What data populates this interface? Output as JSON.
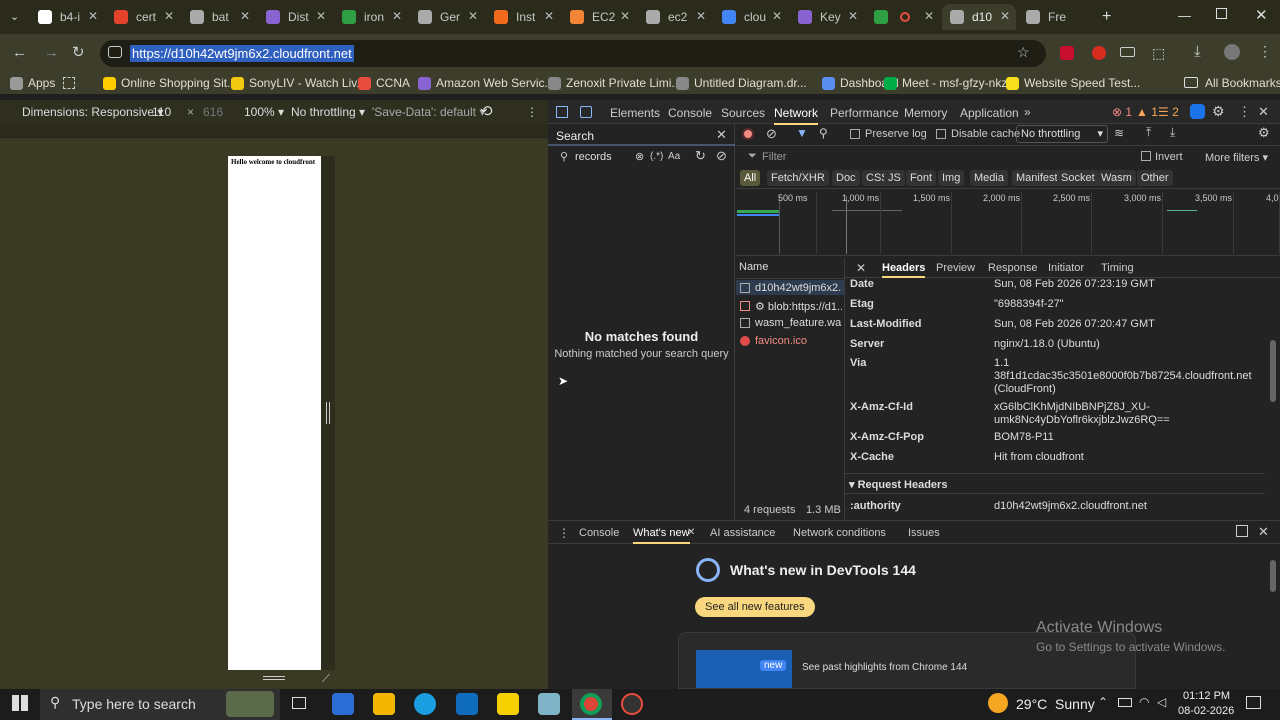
{
  "browser": {
    "tabs": [
      {
        "label": "b4-i",
        "color": "#ffffff"
      },
      {
        "label": "cert",
        "color": "#e24329"
      },
      {
        "label": "bat",
        "color": "#aaaaaa"
      },
      {
        "label": "Dist",
        "color": "#8a63d2"
      },
      {
        "label": "iron",
        "color": "#2ea043"
      },
      {
        "label": "Ger",
        "color": "#aaaaaa"
      },
      {
        "label": "Inst",
        "color": "#f26b1d"
      },
      {
        "label": "EC2",
        "color": "#f58536"
      },
      {
        "label": "ec2",
        "color": "#aaaaaa"
      },
      {
        "label": "clou",
        "color": "#4285f4"
      },
      {
        "label": "Key",
        "color": "#8a63d2"
      },
      {
        "label": "",
        "color": "#2ea043"
      },
      {
        "label": "d10",
        "color": "#aaaaaa"
      },
      {
        "label": "Fre",
        "color": "#aaaaaa"
      }
    ],
    "url": "https://d10h42wt9jm6x2.cloudfront.net",
    "bookmarks": [
      {
        "label": "Apps",
        "color": "#9a9a9a"
      },
      {
        "label": "Online Shopping Sit...",
        "color": "#ffcc00"
      },
      {
        "label": "SonyLIV - Watch Liv...",
        "color": "#f2c811"
      },
      {
        "label": "CCNA",
        "color": "#e84c3d"
      },
      {
        "label": "Amazon Web Servic...",
        "color": "#8a63d2"
      },
      {
        "label": "Zenoxit Private Limi...",
        "color": "#888888"
      },
      {
        "label": "Untitled Diagram.dr...",
        "color": "#888888"
      },
      {
        "label": "Dashboard",
        "color": "#5b8def"
      },
      {
        "label": "Meet - msf-gfzy-nkz",
        "color": "#00ac47"
      },
      {
        "label": "Website Speed Test...",
        "color": "#f7df1e"
      }
    ],
    "all_bookmarks": "All Bookmarks"
  },
  "device_toolbar": {
    "dimensions": "Dimensions: Responsive",
    "width": "110",
    "height": "616",
    "zoom": "100%",
    "throttling": "No throttling",
    "save_data": "'Save-Data': default"
  },
  "page": {
    "text": "Hello welcome to cloudfront"
  },
  "devtools": {
    "tabs": [
      "Elements",
      "Console",
      "Sources",
      "Network",
      "Performance",
      "Memory",
      "Application"
    ],
    "active_tab": "Network",
    "errors": "1",
    "warnings": "1",
    "info": "2",
    "search": {
      "title": "Search",
      "query": "records",
      "regex": "(.*)",
      "case": "Aa",
      "no_matches": "No matches found",
      "no_matches_sub": "Nothing matched your search query"
    },
    "network": {
      "preserve_log": "Preserve log",
      "disable_cache": "Disable cache",
      "throttling": "No throttling",
      "filter_placeholder": "Filter",
      "invert": "Invert",
      "more_filters": "More filters",
      "types": [
        "All",
        "Fetch/XHR",
        "Doc",
        "CSS",
        "JS",
        "Font",
        "Img",
        "Media",
        "Manifest",
        "Socket",
        "Wasm",
        "Other"
      ],
      "timeline_ticks": [
        "500 ms",
        "1,000 ms",
        "1,500 ms",
        "2,000 ms",
        "2,500 ms",
        "3,000 ms",
        "3,500 ms",
        "4,0"
      ],
      "name_header": "Name",
      "requests": [
        {
          "name": "d10h42wt9jm6x2....",
          "error": false
        },
        {
          "name": "⚙ blob:https://d1...",
          "error": false
        },
        {
          "name": "wasm_feature.wa...",
          "error": false
        },
        {
          "name": "favicon.ico",
          "error": true
        }
      ],
      "summary": "4 requests",
      "transferred": "1.3 MB tr",
      "detail_tabs": [
        "Headers",
        "Preview",
        "Response",
        "Initiator",
        "Timing"
      ],
      "headers": [
        {
          "k": "Date",
          "v": "Sun, 08 Feb 2026 07:23:19 GMT"
        },
        {
          "k": "Etag",
          "v": "\"6988394f-27\""
        },
        {
          "k": "Last-Modified",
          "v": "Sun, 08 Feb 2026 07:20:47 GMT"
        },
        {
          "k": "Server",
          "v": "nginx/1.18.0 (Ubuntu)"
        },
        {
          "k": "Via",
          "v": "1.1 38f1d1cdac35c3501e8000f0b7b87254.cloudfront.net (CloudFront)"
        },
        {
          "k": "X-Amz-Cf-Id",
          "v": "xG6lbClKhMjdNIbBNPjZ8J_XU-umk8Nc4yDbYoflr6kxjblzJwz6RQ=="
        },
        {
          "k": "X-Amz-Cf-Pop",
          "v": "BOM78-P11"
        },
        {
          "k": "X-Cache",
          "v": "Hit from cloudfront"
        }
      ],
      "request_headers_title": "▾ Request Headers",
      "authority_key": ":authority",
      "authority_val": "d10h42wt9jm6x2.cloudfront.net"
    },
    "drawer": {
      "tabs": [
        "Console",
        "What's new",
        "AI assistance",
        "Network conditions",
        "Issues"
      ],
      "active": "What's new",
      "title": "What's new in DevTools 144",
      "see_all": "See all new features",
      "badge": "new",
      "highlights": "See past highlights from Chrome 144",
      "activate_title": "Activate Windows",
      "activate_sub": "Go to Settings to activate Windows."
    }
  },
  "taskbar": {
    "search_placeholder": "Type here to search",
    "weather": "29°C  Sunny",
    "time": "01:12 PM",
    "date": "08-02-2026"
  }
}
